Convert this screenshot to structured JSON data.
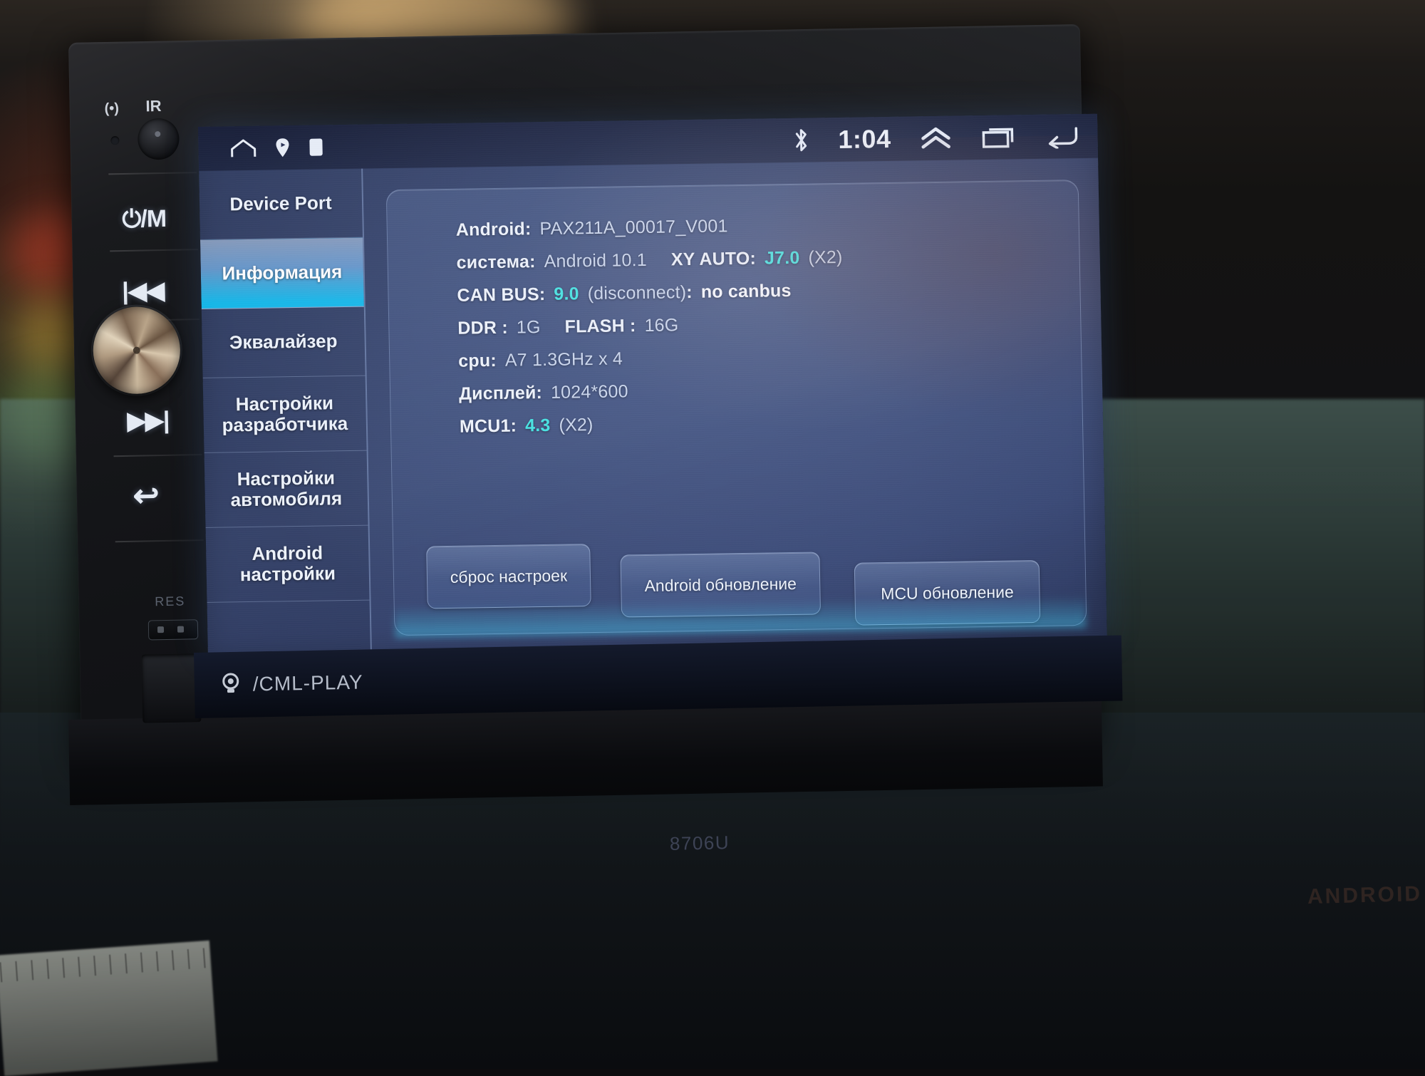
{
  "device": {
    "model_label": "8706U",
    "brand_label": "ANDROID",
    "bottom_bar": {
      "source_label": "/CML-PLAY",
      "camera_icon": "camera-icon"
    }
  },
  "bezel": {
    "ir_label": "IR",
    "remote_label": "(•)",
    "res_label": "RES",
    "buttons": [
      {
        "name": "power-mode",
        "glyph": "⏻/M"
      },
      {
        "name": "previous-track",
        "glyph": "|◀◀"
      },
      {
        "name": "next-track",
        "glyph": "▶▶|"
      },
      {
        "name": "back",
        "glyph": "↩"
      }
    ]
  },
  "statusbar": {
    "left_icons": [
      "home-icon",
      "location-icon",
      "sim-icon"
    ],
    "bluetooth_icon": "bluetooth-icon",
    "time": "1:04",
    "chevron_up_icon": "chevron-up-icon",
    "recents_icon": "recents-icon",
    "back_icon": "back-icon"
  },
  "sidebar": {
    "items": [
      {
        "label": "Device Port",
        "active": false
      },
      {
        "label": "Информация",
        "active": true
      },
      {
        "label": "Эквалайзер",
        "active": false
      },
      {
        "label": "Настройки разработчика",
        "active": false
      },
      {
        "label": "Настройки автомобиля",
        "active": false
      },
      {
        "label": "Android настройки",
        "active": false
      }
    ]
  },
  "info": {
    "android_key": "Android:",
    "android_value": "PAX211A_00017_V001",
    "system_key": "система:",
    "system_value": "Android 10.1",
    "xyauto_key": "XY AUTO:",
    "xyauto_value": "J7.0",
    "xyauto_suffix": "(X2)",
    "canbus_key": "CAN BUS:",
    "canbus_value": "9.0",
    "canbus_state": "(disconnect)",
    "canbus_colon": ":",
    "canbus_detail": "no canbus",
    "ddr_key": "DDR :",
    "ddr_value": "1G",
    "flash_key": "FLASH :",
    "flash_value": "16G",
    "cpu_key": "cpu:",
    "cpu_value": "A7 1.3GHz x 4",
    "display_key": "Дисплей:",
    "display_value": "1024*600",
    "mcu_key": "MCU1:",
    "mcu_value": "4.3",
    "mcu_suffix": "(X2)"
  },
  "actions": {
    "reset_label": "сброс настроек",
    "android_update_label": "Android обновление",
    "mcu_update_label": "MCU обновление"
  },
  "colors": {
    "accent_cyan": "#41e6e0",
    "highlight_blue": "#14bef0",
    "screen_blue": "#3c4a72",
    "text_primary": "#f4f7fc"
  }
}
